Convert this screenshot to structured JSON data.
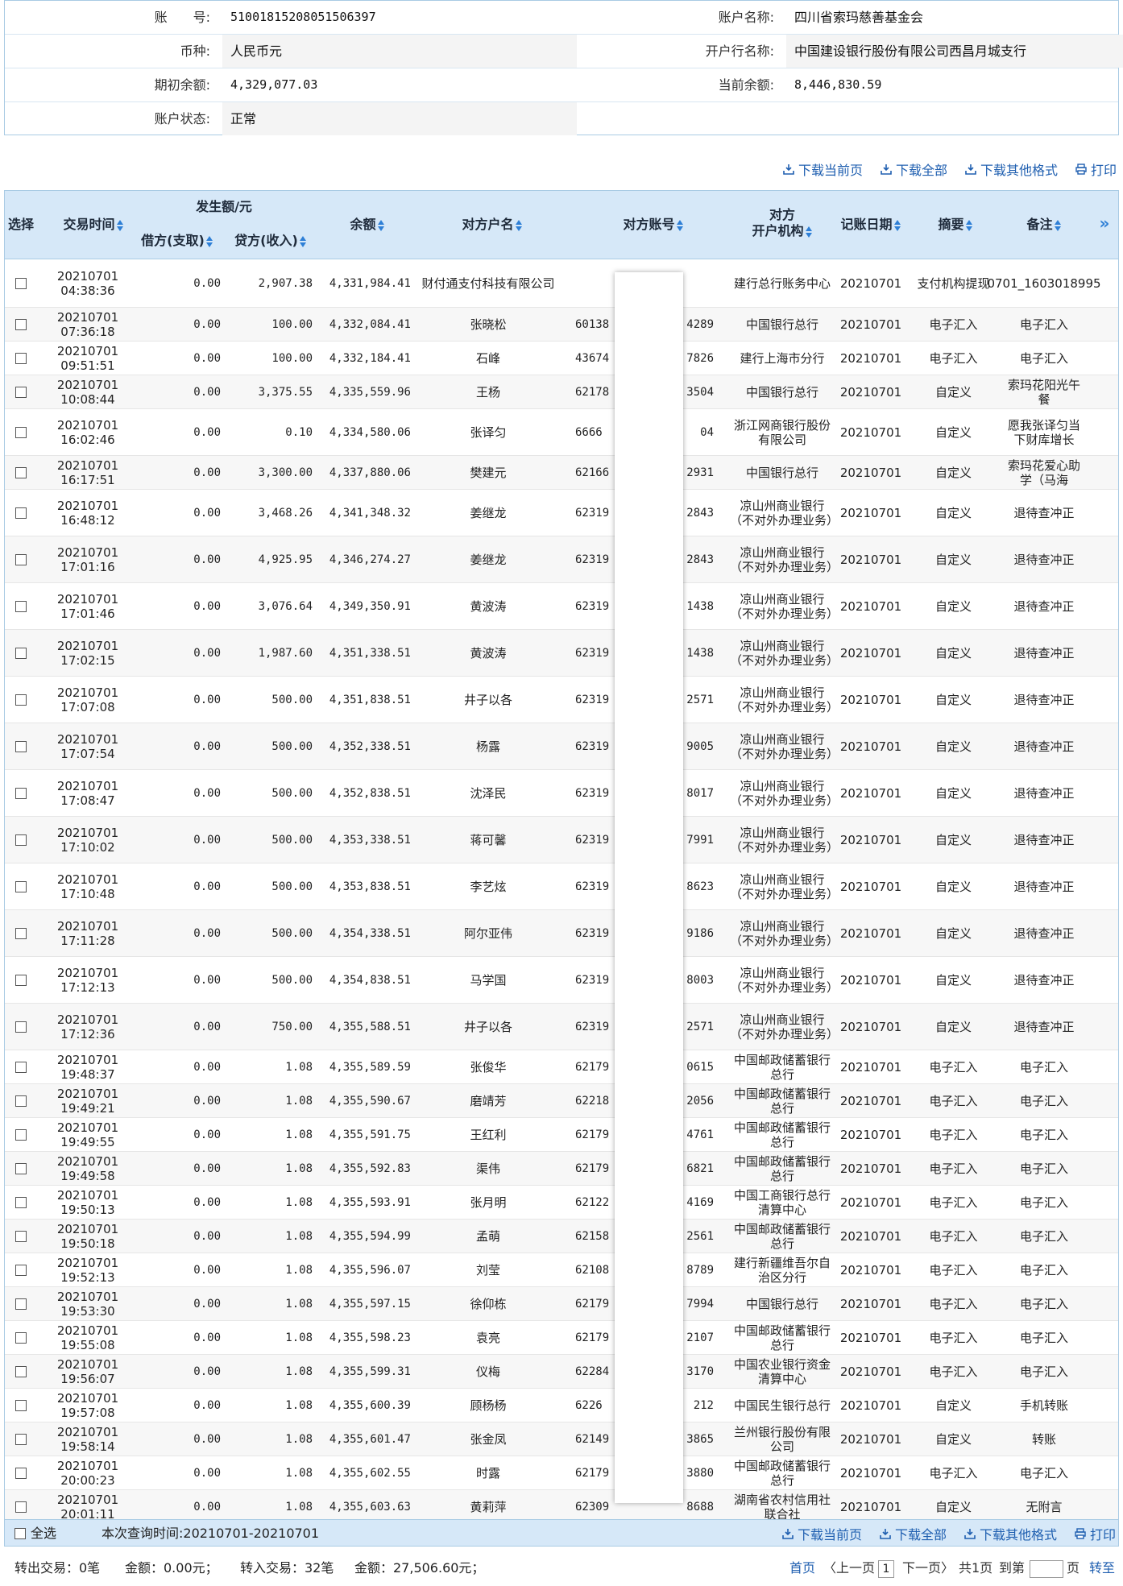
{
  "account": {
    "acct_no_label": "账　　号:",
    "acct_no": "51001815208051506397",
    "acct_name_label": "账户名称:",
    "acct_name": "四川省索玛慈善基金会",
    "currency_label": "币种:",
    "currency": "人民币元",
    "bank_label": "开户行名称:",
    "bank": "中国建设银行股份有限公司西昌月城支行",
    "open_bal_label": "期初余额:",
    "open_bal": "4,329,077.03",
    "cur_bal_label": "当前余额:",
    "cur_bal": "8,446,830.59",
    "status_label": "账户状态:",
    "status": "正常"
  },
  "toolbar": {
    "download_page": "下载当前页",
    "download_all": "下载全部",
    "download_other": "下载其他格式",
    "print": "打印"
  },
  "table": {
    "headers": {
      "select": "选择",
      "time": "交易时间",
      "amount_group": "发生额/元",
      "debit": "借方(支取)",
      "credit": "贷方(收入)",
      "balance": "余额",
      "name": "对方户名",
      "acct": "对方账号",
      "bank_l1": "对方",
      "bank_l2": "开户机构",
      "date": "记账日期",
      "summary": "摘要",
      "note": "备注",
      "more": "»"
    },
    "rows": [
      {
        "d": "20210701",
        "t": "04:38:36",
        "debit": "0.00",
        "credit": "2,907.38",
        "bal": "4,331,984.41",
        "name": "财付通支付科技有限公司",
        "al": "",
        "ar": "",
        "bank": "建行总行账务中心",
        "date": "20210701",
        "sum": "支付机构提现",
        "note": "0701_1603018995"
      },
      {
        "d": "20210701",
        "t": "07:36:18",
        "debit": "0.00",
        "credit": "100.00",
        "bal": "4,332,084.41",
        "name": "张晓松",
        "al": "60138",
        "ar": "4289",
        "bank": "中国银行总行",
        "date": "20210701",
        "sum": "电子汇入",
        "note": "电子汇入"
      },
      {
        "d": "20210701",
        "t": "09:51:51",
        "debit": "0.00",
        "credit": "100.00",
        "bal": "4,332,184.41",
        "name": "石峰",
        "al": "43674",
        "ar": "7826",
        "bank": "建行上海市分行",
        "date": "20210701",
        "sum": "电子汇入",
        "note": "电子汇入"
      },
      {
        "d": "20210701",
        "t": "10:08:44",
        "debit": "0.00",
        "credit": "3,375.55",
        "bal": "4,335,559.96",
        "name": "王杨",
        "al": "62178",
        "ar": "3504",
        "bank": "中国银行总行",
        "date": "20210701",
        "sum": "自定义",
        "note": "索玛花阳光午餐"
      },
      {
        "d": "20210701",
        "t": "16:02:46",
        "debit": "0.00",
        "credit": "0.10",
        "bal": "4,334,580.06",
        "name": "张译匀",
        "al": "6666",
        "ar": "04",
        "bank": "浙江网商银行股份有限公司",
        "date": "20210701",
        "sum": "自定义",
        "note": "愿我张译匀当下财库增长"
      },
      {
        "d": "20210701",
        "t": "16:17:51",
        "debit": "0.00",
        "credit": "3,300.00",
        "bal": "4,337,880.06",
        "name": "樊建元",
        "al": "62166",
        "ar": "2931",
        "bank": "中国银行总行",
        "date": "20210701",
        "sum": "自定义",
        "note": "索玛花爱心助学（马海"
      },
      {
        "d": "20210701",
        "t": "16:48:12",
        "debit": "0.00",
        "credit": "3,468.26",
        "bal": "4,341,348.32",
        "name": "姜继龙",
        "al": "62319",
        "ar": "2843",
        "bank": "凉山州商业银行（不对外办理业务）",
        "date": "20210701",
        "sum": "自定义",
        "note": "退待查冲正"
      },
      {
        "d": "20210701",
        "t": "17:01:16",
        "debit": "0.00",
        "credit": "4,925.95",
        "bal": "4,346,274.27",
        "name": "姜继龙",
        "al": "62319",
        "ar": "2843",
        "bank": "凉山州商业银行（不对外办理业务）",
        "date": "20210701",
        "sum": "自定义",
        "note": "退待查冲正"
      },
      {
        "d": "20210701",
        "t": "17:01:46",
        "debit": "0.00",
        "credit": "3,076.64",
        "bal": "4,349,350.91",
        "name": "黄波涛",
        "al": "62319",
        "ar": "1438",
        "bank": "凉山州商业银行（不对外办理业务）",
        "date": "20210701",
        "sum": "自定义",
        "note": "退待查冲正"
      },
      {
        "d": "20210701",
        "t": "17:02:15",
        "debit": "0.00",
        "credit": "1,987.60",
        "bal": "4,351,338.51",
        "name": "黄波涛",
        "al": "62319",
        "ar": "1438",
        "bank": "凉山州商业银行（不对外办理业务）",
        "date": "20210701",
        "sum": "自定义",
        "note": "退待查冲正"
      },
      {
        "d": "20210701",
        "t": "17:07:08",
        "debit": "0.00",
        "credit": "500.00",
        "bal": "4,351,838.51",
        "name": "井子以各",
        "al": "62319",
        "ar": "2571",
        "bank": "凉山州商业银行（不对外办理业务）",
        "date": "20210701",
        "sum": "自定义",
        "note": "退待查冲正"
      },
      {
        "d": "20210701",
        "t": "17:07:54",
        "debit": "0.00",
        "credit": "500.00",
        "bal": "4,352,338.51",
        "name": "杨露",
        "al": "62319",
        "ar": "9005",
        "bank": "凉山州商业银行（不对外办理业务）",
        "date": "20210701",
        "sum": "自定义",
        "note": "退待查冲正"
      },
      {
        "d": "20210701",
        "t": "17:08:47",
        "debit": "0.00",
        "credit": "500.00",
        "bal": "4,352,838.51",
        "name": "沈泽民",
        "al": "62319",
        "ar": "8017",
        "bank": "凉山州商业银行（不对外办理业务）",
        "date": "20210701",
        "sum": "自定义",
        "note": "退待查冲正"
      },
      {
        "d": "20210701",
        "t": "17:10:02",
        "debit": "0.00",
        "credit": "500.00",
        "bal": "4,353,338.51",
        "name": "蒋可馨",
        "al": "62319",
        "ar": "7991",
        "bank": "凉山州商业银行（不对外办理业务）",
        "date": "20210701",
        "sum": "自定义",
        "note": "退待查冲正"
      },
      {
        "d": "20210701",
        "t": "17:10:48",
        "debit": "0.00",
        "credit": "500.00",
        "bal": "4,353,838.51",
        "name": "李艺炫",
        "al": "62319",
        "ar": "8623",
        "bank": "凉山州商业银行（不对外办理业务）",
        "date": "20210701",
        "sum": "自定义",
        "note": "退待查冲正"
      },
      {
        "d": "20210701",
        "t": "17:11:28",
        "debit": "0.00",
        "credit": "500.00",
        "bal": "4,354,338.51",
        "name": "阿尔亚伟",
        "al": "62319",
        "ar": "9186",
        "bank": "凉山州商业银行（不对外办理业务）",
        "date": "20210701",
        "sum": "自定义",
        "note": "退待查冲正"
      },
      {
        "d": "20210701",
        "t": "17:12:13",
        "debit": "0.00",
        "credit": "500.00",
        "bal": "4,354,838.51",
        "name": "马学国",
        "al": "62319",
        "ar": "8003",
        "bank": "凉山州商业银行（不对外办理业务）",
        "date": "20210701",
        "sum": "自定义",
        "note": "退待查冲正"
      },
      {
        "d": "20210701",
        "t": "17:12:36",
        "debit": "0.00",
        "credit": "750.00",
        "bal": "4,355,588.51",
        "name": "井子以各",
        "al": "62319",
        "ar": "2571",
        "bank": "凉山州商业银行（不对外办理业务）",
        "date": "20210701",
        "sum": "自定义",
        "note": "退待查冲正"
      },
      {
        "d": "20210701",
        "t": "19:48:37",
        "debit": "0.00",
        "credit": "1.08",
        "bal": "4,355,589.59",
        "name": "张俊华",
        "al": "62179",
        "ar": "0615",
        "bank": "中国邮政储蓄银行总行",
        "date": "20210701",
        "sum": "电子汇入",
        "note": "电子汇入"
      },
      {
        "d": "20210701",
        "t": "19:49:21",
        "debit": "0.00",
        "credit": "1.08",
        "bal": "4,355,590.67",
        "name": "磨靖芳",
        "al": "62218",
        "ar": "2056",
        "bank": "中国邮政储蓄银行总行",
        "date": "20210701",
        "sum": "电子汇入",
        "note": "电子汇入"
      },
      {
        "d": "20210701",
        "t": "19:49:55",
        "debit": "0.00",
        "credit": "1.08",
        "bal": "4,355,591.75",
        "name": "王红利",
        "al": "62179",
        "ar": "4761",
        "bank": "中国邮政储蓄银行总行",
        "date": "20210701",
        "sum": "电子汇入",
        "note": "电子汇入"
      },
      {
        "d": "20210701",
        "t": "19:49:58",
        "debit": "0.00",
        "credit": "1.08",
        "bal": "4,355,592.83",
        "name": "渠伟",
        "al": "62179",
        "ar": "6821",
        "bank": "中国邮政储蓄银行总行",
        "date": "20210701",
        "sum": "电子汇入",
        "note": "电子汇入"
      },
      {
        "d": "20210701",
        "t": "19:50:13",
        "debit": "0.00",
        "credit": "1.08",
        "bal": "4,355,593.91",
        "name": "张月明",
        "al": "62122",
        "ar": "4169",
        "bank": "中国工商银行总行清算中心",
        "date": "20210701",
        "sum": "电子汇入",
        "note": "电子汇入"
      },
      {
        "d": "20210701",
        "t": "19:50:18",
        "debit": "0.00",
        "credit": "1.08",
        "bal": "4,355,594.99",
        "name": "孟萌",
        "al": "62158",
        "ar": "2561",
        "bank": "中国邮政储蓄银行总行",
        "date": "20210701",
        "sum": "电子汇入",
        "note": "电子汇入"
      },
      {
        "d": "20210701",
        "t": "19:52:13",
        "debit": "0.00",
        "credit": "1.08",
        "bal": "4,355,596.07",
        "name": "刘莹",
        "al": "62108",
        "ar": "8789",
        "bank": "建行新疆维吾尔自治区分行",
        "date": "20210701",
        "sum": "电子汇入",
        "note": "电子汇入"
      },
      {
        "d": "20210701",
        "t": "19:53:30",
        "debit": "0.00",
        "credit": "1.08",
        "bal": "4,355,597.15",
        "name": "徐仰栋",
        "al": "62179",
        "ar": "7994",
        "bank": "中国银行总行",
        "date": "20210701",
        "sum": "电子汇入",
        "note": "电子汇入"
      },
      {
        "d": "20210701",
        "t": "19:55:08",
        "debit": "0.00",
        "credit": "1.08",
        "bal": "4,355,598.23",
        "name": "袁亮",
        "al": "62179",
        "ar": "2107",
        "bank": "中国邮政储蓄银行总行",
        "date": "20210701",
        "sum": "电子汇入",
        "note": "电子汇入"
      },
      {
        "d": "20210701",
        "t": "19:56:07",
        "debit": "0.00",
        "credit": "1.08",
        "bal": "4,355,599.31",
        "name": "仪梅",
        "al": "62284",
        "ar": "3170",
        "bank": "中国农业银行资金清算中心",
        "date": "20210701",
        "sum": "电子汇入",
        "note": "电子汇入"
      },
      {
        "d": "20210701",
        "t": "19:57:08",
        "debit": "0.00",
        "credit": "1.08",
        "bal": "4,355,600.39",
        "name": "顾杨杨",
        "al": "6226",
        "ar": "212",
        "bank": "中国民生银行总行",
        "date": "20210701",
        "sum": "自定义",
        "note": "手机转账"
      },
      {
        "d": "20210701",
        "t": "19:58:14",
        "debit": "0.00",
        "credit": "1.08",
        "bal": "4,355,601.47",
        "name": "张金凤",
        "al": "62149",
        "ar": "3865",
        "bank": "兰州银行股份有限公司",
        "date": "20210701",
        "sum": "自定义",
        "note": "转账"
      },
      {
        "d": "20210701",
        "t": "20:00:23",
        "debit": "0.00",
        "credit": "1.08",
        "bal": "4,355,602.55",
        "name": "时露",
        "al": "62179",
        "ar": "3880",
        "bank": "中国邮政储蓄银行总行",
        "date": "20210701",
        "sum": "电子汇入",
        "note": "电子汇入"
      },
      {
        "d": "20210701",
        "t": "20:01:11",
        "debit": "0.00",
        "credit": "1.08",
        "bal": "4,355,603.63",
        "name": "黄莉萍",
        "al": "62309",
        "ar": "8688",
        "bank": "湖南省农村信用社联合社",
        "date": "20210701",
        "sum": "自定义",
        "note": "无附言"
      }
    ]
  },
  "footer": {
    "select_all": "全选",
    "query_time": "本次查询时间:20210701-20210701",
    "out_count": "转出交易：0笔",
    "out_amount": "金额：0.00元；",
    "in_count": "转入交易：32笔",
    "in_amount": "金额：27,506.60元；",
    "first": "首页",
    "prev": "〈上一页",
    "page": "1",
    "next": "下一页〉",
    "total": "共1页",
    "goto_pre": "到第",
    "goto_post": "页",
    "go": "转至"
  },
  "colors": {
    "header_bg": "#d6e8f8",
    "link": "#1f5fb0",
    "border": "#a9cbe4",
    "sort_arrow": "#2e7fd6"
  }
}
